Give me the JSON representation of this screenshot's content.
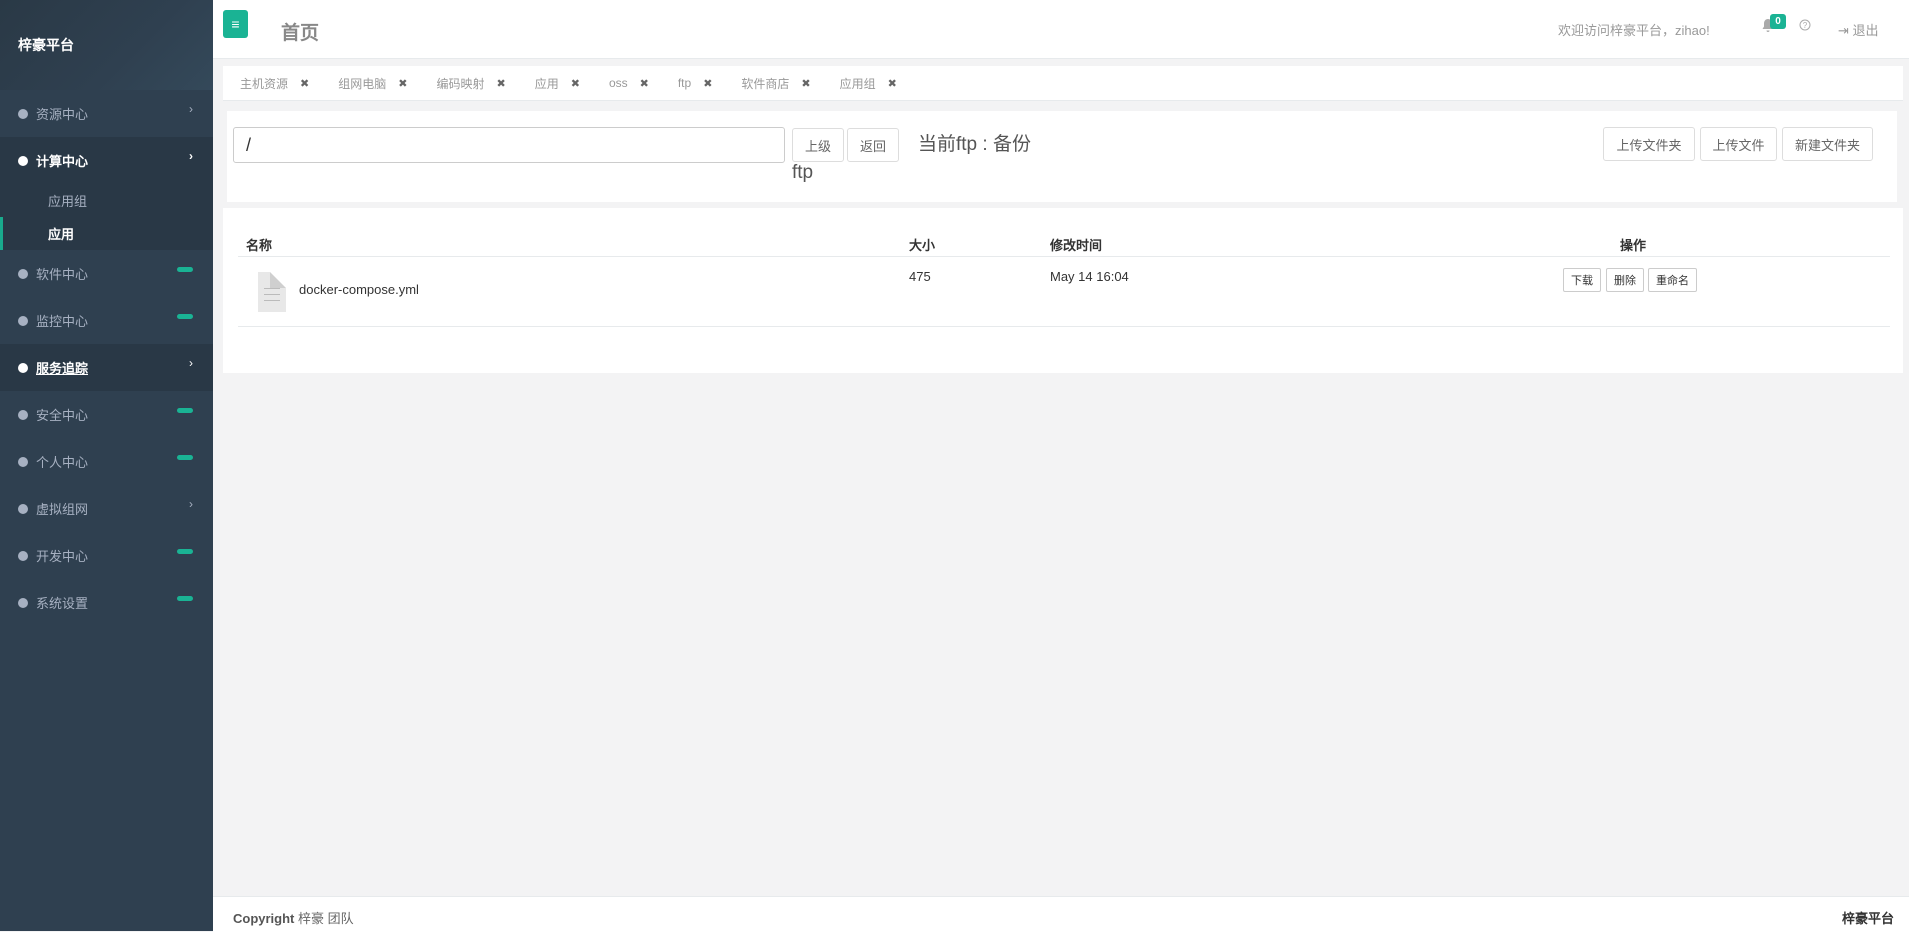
{
  "app": {
    "brand": "梓豪平台"
  },
  "sidebar": {
    "items": [
      {
        "label": "资源中心"
      },
      {
        "label": "计算中心"
      },
      {
        "label": "软件中心"
      },
      {
        "label": "监控中心"
      },
      {
        "label": "服务追踪"
      },
      {
        "label": "安全中心"
      },
      {
        "label": "个人中心"
      },
      {
        "label": "虚拟组网"
      },
      {
        "label": "开发中心"
      },
      {
        "label": "系统设置"
      }
    ],
    "subitems": [
      {
        "label": "应用组"
      },
      {
        "label": "应用"
      }
    ]
  },
  "header": {
    "menu_icon": "menu-icon",
    "title": "首页",
    "welcome": "欢迎访问梓豪平台，zihao!",
    "notifications": "0",
    "logout": "退出"
  },
  "tabs": [
    {
      "label": "主机资源"
    },
    {
      "label": "组网电脑"
    },
    {
      "label": "编码映射"
    },
    {
      "label": "应用"
    },
    {
      "label": "oss"
    },
    {
      "label": "ftp"
    },
    {
      "label": "软件商店"
    },
    {
      "label": "应用组"
    }
  ],
  "toolbar": {
    "path_value": "/",
    "up_label": "上级",
    "back_label": "返回",
    "current_ftp_line1": "当前ftp : 备份",
    "current_ftp_line2": "ftp",
    "upload_folder_label": "上传文件夹",
    "upload_file_label": "上传文件",
    "new_folder_label": "新建文件夹"
  },
  "table": {
    "headers": {
      "name": "名称",
      "size": "大小",
      "modified": "修改时间",
      "actions": "操作"
    },
    "rows": [
      {
        "name": "docker-compose.yml",
        "size": "475",
        "modified": "May 14 16:04",
        "download": "下载",
        "delete": "删除",
        "rename": "重命名"
      }
    ]
  },
  "footer": {
    "copyright_bold": "Copyright",
    "copyright_text": "梓豪 团队",
    "brand": "梓豪平台"
  },
  "colors": {
    "sidebar_bg": "#2f4050",
    "accent": "#1ab394",
    "page_bg": "#f3f3f4"
  }
}
